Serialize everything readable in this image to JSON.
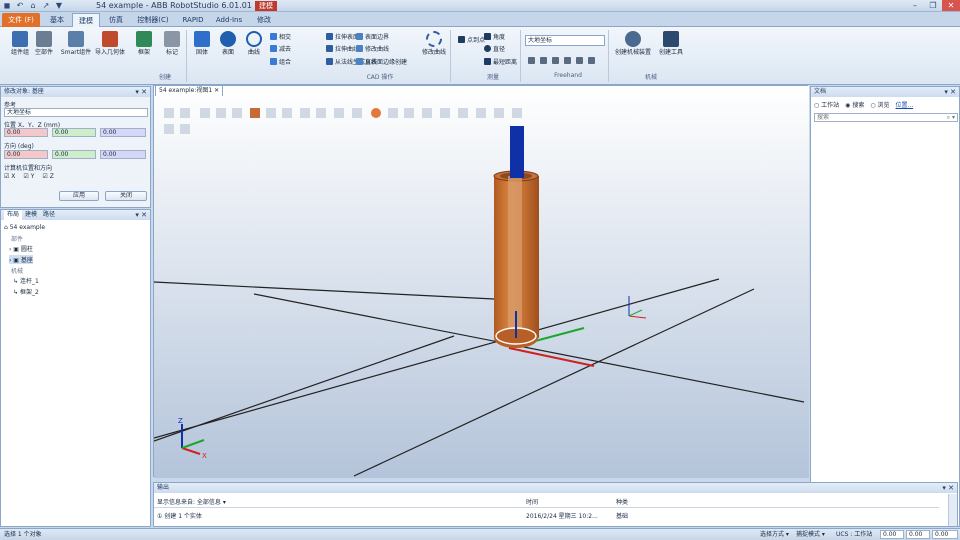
{
  "window": {
    "title": "54 example - ABB RobotStudio 6.01.01",
    "context_tab": "建模",
    "min": "–",
    "restore": "❐",
    "close": "✕"
  },
  "qat": [
    "◼",
    "↶",
    "⌂",
    "↗",
    "▼"
  ],
  "tabs": [
    {
      "label": "文件 (F)"
    },
    {
      "label": "基本"
    },
    {
      "label": "建模"
    },
    {
      "label": "仿真"
    },
    {
      "label": "控制器(C)"
    },
    {
      "label": "RAPID"
    },
    {
      "label": "Add-Ins"
    },
    {
      "label": "修改"
    }
  ],
  "ribbon": {
    "big": [
      {
        "label": "组件组"
      },
      {
        "label": "空部件"
      },
      {
        "label": "Smart组件"
      },
      {
        "label": "导入几何体"
      },
      {
        "label": "框架"
      },
      {
        "label": "标记"
      },
      {
        "label": "固体"
      },
      {
        "label": "表面"
      },
      {
        "label": "曲线"
      }
    ],
    "cad": [
      "相交",
      "减去",
      "组合",
      "拉伸表面",
      "拉伸曲线",
      "从法线生成直线",
      "表面边界",
      "修改曲线",
      "从表面边缘创建"
    ],
    "measure": [
      "点到点",
      "角度",
      "直径",
      "最短距离"
    ],
    "freehand_select": "大地坐标",
    "mech": [
      {
        "label": "创建机械装置"
      },
      {
        "label": "创建工具"
      }
    ],
    "groups": [
      "创建",
      "CAD 操作",
      "测量",
      "Freehand",
      "机械"
    ],
    "extra": [
      "修改曲线"
    ]
  },
  "left_panel": {
    "title": "修改对象: 基座",
    "ref_label": "参考",
    "ref_value": "大地坐标",
    "pos_label": "位置 X、Y、Z (mm)",
    "pos": [
      "0.00",
      "0.00",
      "0.00"
    ],
    "ori_label": "方向 (deg)",
    "ori": [
      "0.00",
      "0.00",
      "0.00"
    ],
    "axes_label": "计算机位置和方向",
    "checks": [
      "X",
      "Y",
      "Z"
    ],
    "apply": "应用",
    "close": "关闭"
  },
  "layout": {
    "tabs": [
      "布局",
      "建模",
      "路径"
    ],
    "nodes": [
      "54 example",
      "部件",
      "圆柱",
      "基座",
      "机械",
      "连杆_1",
      "框架_2"
    ]
  },
  "viewport": {
    "tab": "54 example:视图1"
  },
  "right_panel": {
    "title": "文档",
    "radios": [
      "工作站",
      "搜索",
      "浏览"
    ],
    "link": "位置...",
    "search_placeholder": "搜索"
  },
  "output": {
    "title": "输出",
    "header_left": "显示信息来自: 全部信息",
    "header_time": "时间",
    "header_cat": "种类",
    "row_msg": "① 创建 1 个实体",
    "row_time": "2016/2/24 星期三 10:2...",
    "row_cat": "基础"
  },
  "status": {
    "left": "选择 1 个对象",
    "mid1": "选择方式 ▾",
    "mid2": "捕捉模式 ▾",
    "ucs": "UCS : 工作站",
    "coords": [
      "0.00",
      "0.00",
      "0.00"
    ]
  },
  "colors": {
    "file_tab": "#e0702a",
    "cylinder": "#c8682a",
    "pin": "#1030a8"
  }
}
